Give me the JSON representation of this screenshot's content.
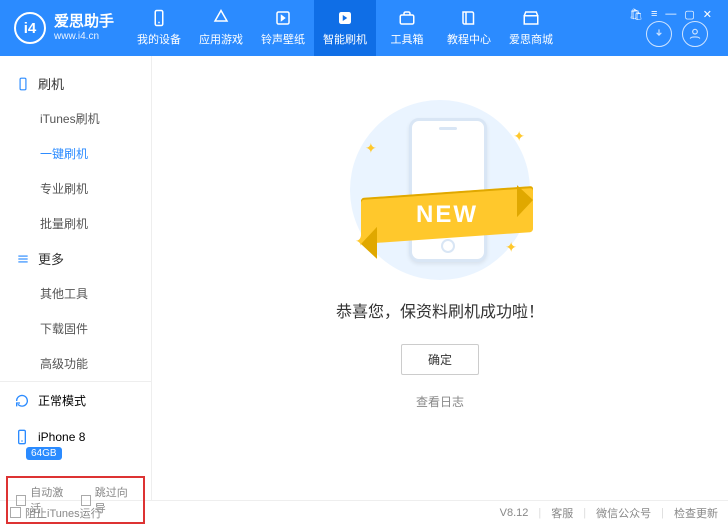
{
  "brand": {
    "title": "爱思助手",
    "subtitle": "www.i4.cn",
    "logo_text": "i4"
  },
  "nav": [
    {
      "label": "我的设备",
      "icon": "phone"
    },
    {
      "label": "应用游戏",
      "icon": "apps"
    },
    {
      "label": "铃声壁纸",
      "icon": "music"
    },
    {
      "label": "智能刷机",
      "icon": "flash",
      "active": true
    },
    {
      "label": "工具箱",
      "icon": "toolbox"
    },
    {
      "label": "教程中心",
      "icon": "book"
    },
    {
      "label": "爱思商城",
      "icon": "store"
    }
  ],
  "sidebar": {
    "group1": {
      "title": "刷机",
      "items": [
        "iTunes刷机",
        "一键刷机",
        "专业刷机",
        "批量刷机"
      ],
      "active_index": 1
    },
    "group2": {
      "title": "更多",
      "items": [
        "其他工具",
        "下载固件",
        "高级功能"
      ]
    },
    "mode": "正常模式",
    "device": "iPhone 8",
    "storage": "64GB",
    "bottom": {
      "opt1": "自动激活",
      "opt2": "跳过向导"
    }
  },
  "main": {
    "ribbon": "NEW",
    "success": "恭喜您，保资料刷机成功啦！",
    "ok": "确定",
    "view_log": "查看日志"
  },
  "footer": {
    "block_itunes": "阻止iTunes运行",
    "version": "V8.12",
    "links": [
      "客服",
      "微信公众号",
      "检查更新"
    ]
  }
}
